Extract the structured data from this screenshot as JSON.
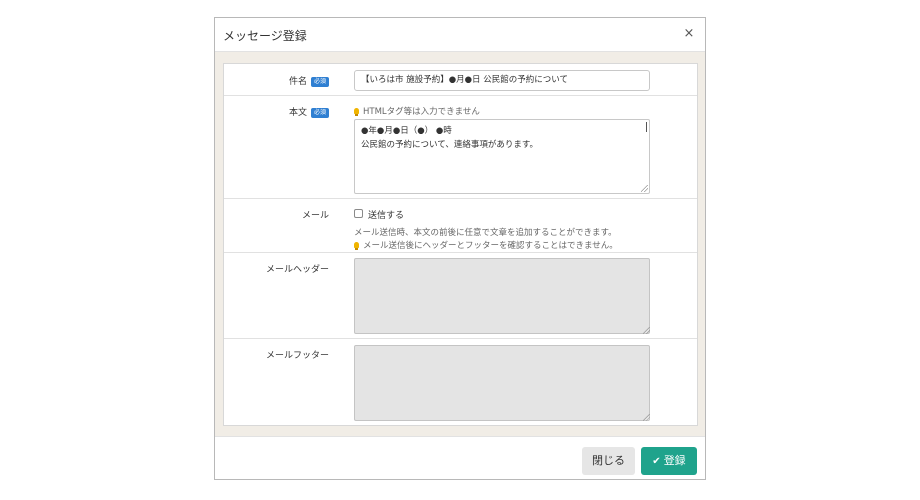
{
  "dialog": {
    "title": "メッセージ登録",
    "close_symbol": "×"
  },
  "form": {
    "required_badge": "必須",
    "subject": {
      "label": "件名",
      "value": "【いろは市 施設予約】●月●日 公民館の予約について"
    },
    "body": {
      "label": "本文",
      "hint": "HTMLタグ等は入力できません",
      "value": "●年●月●日（●） ●時\n公民館の予約について、連絡事項があります。"
    },
    "mail": {
      "label": "メール",
      "checkbox_label": "送信する",
      "checked": false,
      "note": "メール送信時、本文の前後に任意で文章を追加することができます。",
      "warning": "メール送信後にヘッダーとフッターを確認することはできません。"
    },
    "mail_header": {
      "label": "メールヘッダー",
      "value": ""
    },
    "mail_footer": {
      "label": "メールフッター",
      "value": ""
    }
  },
  "footer": {
    "close_label": "閉じる",
    "submit_label": "登録",
    "submit_icon": "✔"
  },
  "colors": {
    "primary": "#1fa38c",
    "required_badge": "#2f7fd2",
    "hint_bulb": "#f0b400"
  }
}
